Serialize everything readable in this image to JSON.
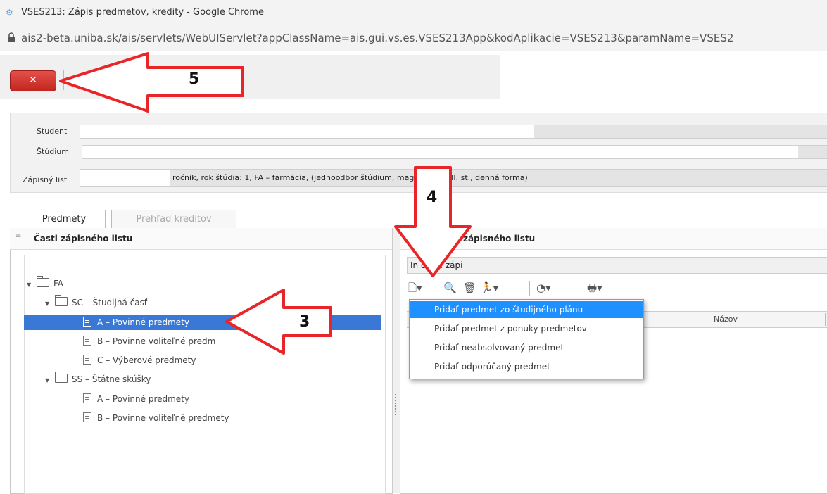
{
  "window": {
    "title": "VSES213: Zápis predmetov, kredity - Google Chrome"
  },
  "address": {
    "url": "ais2-beta.uniba.sk/ais/servlets/WebUIServlet?appClassName=ais.gui.vs.es.VSES213App&kodAplikacie=VSES213&paramName=VSES2"
  },
  "toolbar": {
    "close_label": "✕"
  },
  "form": {
    "student_label": "Študent",
    "studium_label": "Štúdium",
    "zapisny_label": "Zápisný list",
    "zapisny_value": "ročník, rok štúdia: 1, FA – farmácia, (jednoodbor štúdium, magisterský I.II. st., denná forma)"
  },
  "tabs": [
    {
      "label": "Predmety",
      "active": true
    },
    {
      "label": "Prehľad kreditov",
      "active": false
    }
  ],
  "left_panel": {
    "title": "Časti zápisného listu",
    "tree": [
      {
        "label": "FA",
        "level": 0,
        "kind": "folder"
      },
      {
        "label": "SC – Študijná časť",
        "level": 1,
        "kind": "folder"
      },
      {
        "label": "A – Povinné predmety",
        "level": 2,
        "kind": "doc",
        "selected": true
      },
      {
        "label": "B – Povinne voliteľné predm",
        "level": 2,
        "kind": "doc"
      },
      {
        "label": "C – Výberové predmety",
        "level": 2,
        "kind": "doc"
      },
      {
        "label": "SS – Štátne skúšky",
        "level": 1,
        "kind": "folder"
      },
      {
        "label": "A – Povinné predmety",
        "level": 2,
        "kind": "doc"
      },
      {
        "label": "B – Povinne voliteľné predmety",
        "level": 2,
        "kind": "doc"
      }
    ]
  },
  "right_panel": {
    "title": "y zápisného listu",
    "info_text": "In     d pre zápi",
    "grid": {
      "col_name": "Názov"
    }
  },
  "dropdown": {
    "items": [
      {
        "label": "Pridať predmet zo študijného plánu",
        "highlight": true
      },
      {
        "label": "Pridať predmet z ponuky predmetov"
      },
      {
        "label": "Pridať neabsolvovaný predmet"
      },
      {
        "label": "Pridať odporúčaný predmet"
      }
    ]
  },
  "callouts": {
    "n3": "3",
    "n4": "4",
    "n5": "5"
  },
  "colors": {
    "selection": "#3a78d6",
    "menu_highlight": "#1e90ff",
    "callout": "#e8262a",
    "close_button": "#d43a33"
  }
}
